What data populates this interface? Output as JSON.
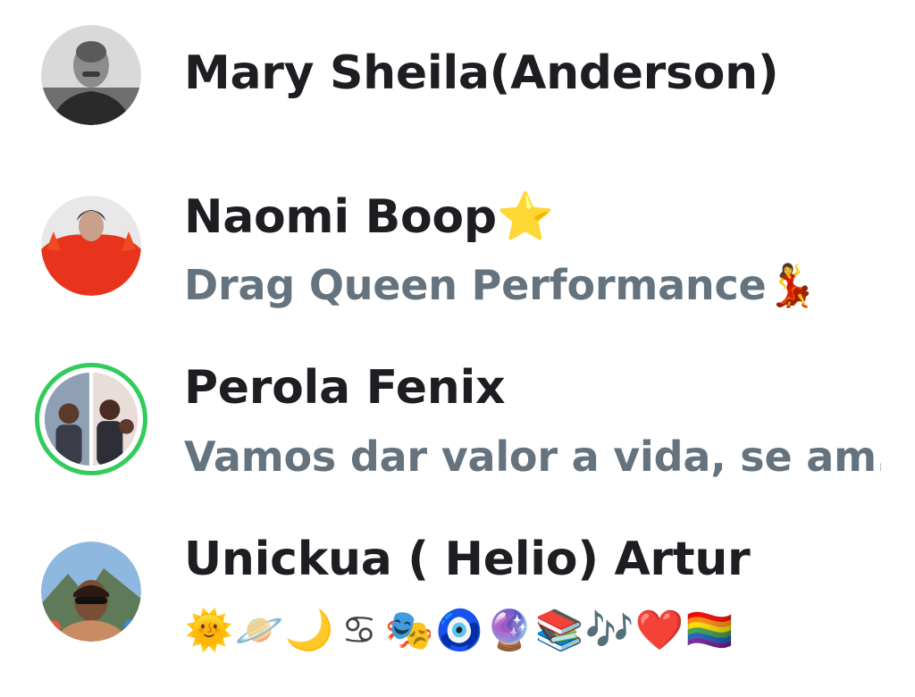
{
  "contacts": [
    {
      "name": "Mary Sheila(Anderson)",
      "name_emoji": "",
      "subtitle": "",
      "subtitle_emoji": "",
      "has_story": false
    },
    {
      "name": "Naomi Boop",
      "name_emoji": "⭐",
      "subtitle": "Drag Queen Performance",
      "subtitle_emoji": "💃",
      "has_story": false
    },
    {
      "name": "Perola Fenix",
      "name_emoji": "",
      "subtitle": "Vamos dar valor a vida, se am...",
      "subtitle_emoji": "",
      "has_story": true
    },
    {
      "name": "Unickua ( Helio) Artur",
      "name_emoji": "",
      "subtitle": "",
      "subtitle_emoji": "",
      "has_story": false,
      "status_emojis": [
        "🌞",
        "🪐",
        "🌙",
        "♋",
        "🎭",
        "🧿",
        "🔮",
        "📚",
        "🎶",
        "❤️",
        "🏳️‍🌈"
      ]
    }
  ],
  "colors": {
    "name": "#1c1e21",
    "subtitle": "#65737e",
    "story_ring": "#31cc5c",
    "background": "#ffffff"
  }
}
